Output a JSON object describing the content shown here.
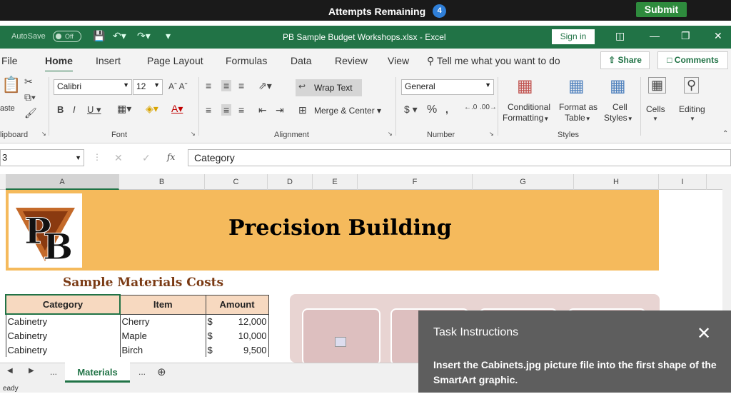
{
  "top": {
    "attempts_label": "Attempts Remaining",
    "attempts_count": "4",
    "submit": "Submit"
  },
  "titlebar": {
    "autosave": "AutoSave",
    "autosave_state": "Off",
    "title": "PB Sample Budget Workshops.xlsx - Excel",
    "signin": "Sign in"
  },
  "menu": {
    "items": [
      "File",
      "Home",
      "Insert",
      "Page Layout",
      "Formulas",
      "Data",
      "Review",
      "View"
    ],
    "tell": "Tell me what you want to do",
    "share": "Share",
    "comments": "Comments"
  },
  "ribbon": {
    "paste": "aste",
    "clipboard": "lipboard",
    "font_name": "Calibri",
    "font_size": "12",
    "font_group": "Font",
    "wrap_text": "Wrap Text",
    "merge_center": "Merge & Center",
    "alignment_group": "Alignment",
    "number_format": "General",
    "number_group": "Number",
    "conditional": [
      "Conditional",
      "Formatting"
    ],
    "format_as": [
      "Format as",
      "Table"
    ],
    "cell_styles": [
      "Cell",
      "Styles"
    ],
    "styles_group": "Styles",
    "cells": "Cells",
    "editing": "Editing"
  },
  "formula": {
    "namebox": "3",
    "content": "Category"
  },
  "columns": [
    "A",
    "B",
    "C",
    "D",
    "E",
    "F",
    "G",
    "H",
    "I"
  ],
  "sheet": {
    "company": "Precision Building",
    "materials_title": "Sample Materials Costs",
    "headers": [
      "Category",
      "Item",
      "Amount"
    ],
    "rows": [
      {
        "category": "Cabinetry",
        "item": "Cherry",
        "currency": "$",
        "amount": "12,000"
      },
      {
        "category": "Cabinetry",
        "item": "Maple",
        "currency": "$",
        "amount": "10,000"
      },
      {
        "category": "Cabinetry",
        "item": "Birch",
        "currency": "$",
        "amount": "9,500"
      }
    ]
  },
  "tabs": {
    "more": "...",
    "active": "Materials",
    "more2": "...",
    "status": "eady"
  },
  "task": {
    "title": "Task Instructions",
    "body": "Insert the Cabinets.jpg picture file into the first shape of the SmartArt graphic."
  }
}
